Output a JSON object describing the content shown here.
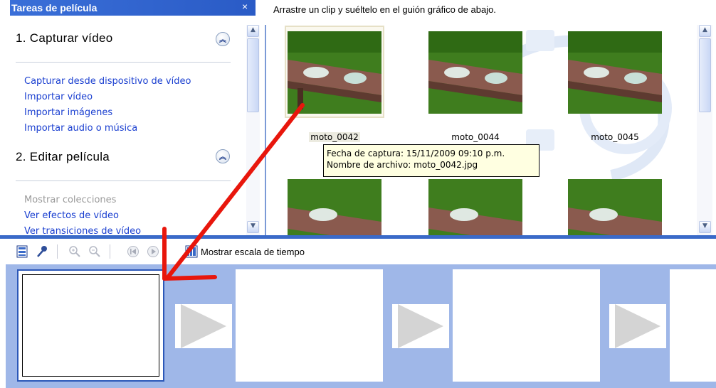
{
  "tasks_pane": {
    "title": "Tareas de película",
    "close_label": "×",
    "sections": [
      {
        "title": "1. Capturar vídeo",
        "links": [
          {
            "label": "Capturar desde dispositivo de vídeo",
            "enabled": true
          },
          {
            "label": "Importar vídeo",
            "enabled": true
          },
          {
            "label": "Importar imágenes",
            "enabled": true
          },
          {
            "label": "Importar audio o música",
            "enabled": true
          }
        ]
      },
      {
        "title": "2. Editar película",
        "links": [
          {
            "label": "Mostrar colecciones",
            "enabled": false
          },
          {
            "label": "Ver efectos de vídeo",
            "enabled": true
          },
          {
            "label": "Ver transiciones de vídeo",
            "enabled": true
          }
        ]
      }
    ]
  },
  "collection_pane": {
    "hint": "Arrastre un clip y suéltelo en el guión gráfico de abajo.",
    "clips": [
      {
        "label": "moto_0042",
        "selected": true
      },
      {
        "label": "moto_0044",
        "selected": false
      },
      {
        "label": "moto_0045",
        "selected": false
      },
      {
        "label": "",
        "selected": false
      },
      {
        "label": "",
        "selected": false
      },
      {
        "label": "",
        "selected": false
      }
    ],
    "tooltip": {
      "line1": "Fecha de captura: 15/11/2009 09:10 p.m.",
      "line2": "Nombre de archivo: moto_0042.jpg"
    }
  },
  "toolbar": {
    "icons": [
      "storyboard-icon",
      "narrate-icon",
      "zoom-in-icon",
      "zoom-out-icon",
      "rewind-icon",
      "play-icon"
    ],
    "timeline_toggle_label": "Mostrar escala de tiempo"
  },
  "storyboard": {
    "cell_count": 4,
    "selected_cell": 0
  },
  "colors": {
    "header_blue": "#2a5bc6",
    "link_blue": "#1a3fd0",
    "storyboard_bg": "#9fb7e8",
    "tooltip_bg": "#ffffe1",
    "arrow_red": "#e8160c"
  }
}
